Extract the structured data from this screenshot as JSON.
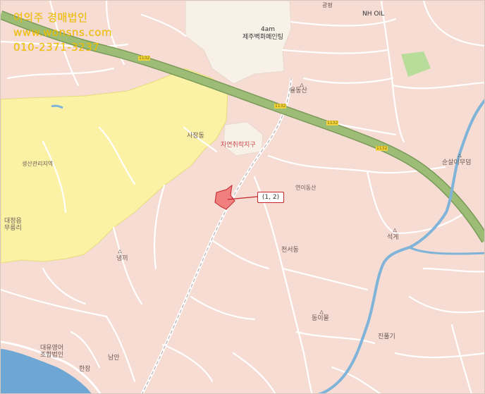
{
  "watermark": {
    "company": "여의주 경매법인",
    "website": "www.wonsns.com",
    "phone": "010-2371-3237"
  },
  "callout": {
    "text": "(1, 2)"
  },
  "labels": {
    "top_road": "광평",
    "nh_oil": "NH OIL",
    "building_4am": "4am",
    "building_name": "제주벽화페인팅",
    "yuldong": "율동산",
    "sajang": "사장동",
    "natural_zone": "자연취락지구",
    "production_zone": "생산관리지역",
    "left_town_line1": "대정읍",
    "left_town_line2": "무릉리",
    "nae_ggi": "냉끼",
    "cheonseo": "천서동",
    "yeongi": "연이동산",
    "seokgye": "석게",
    "sunsan": "순살이무덤",
    "dongi": "동이물",
    "jinpul": "진풀기",
    "corp_line1": "대유영어",
    "corp_line2": "조합법인",
    "namwon": "남안",
    "hanjang": "한장",
    "sign_1": "1132"
  },
  "colors": {
    "land": "#f6dcd3",
    "highway": "#8fb06a",
    "agri_zone": "#fbf2a6",
    "water": "#7fb4d8",
    "parcel": "#ef6f6f",
    "leader": "#c1272d"
  }
}
